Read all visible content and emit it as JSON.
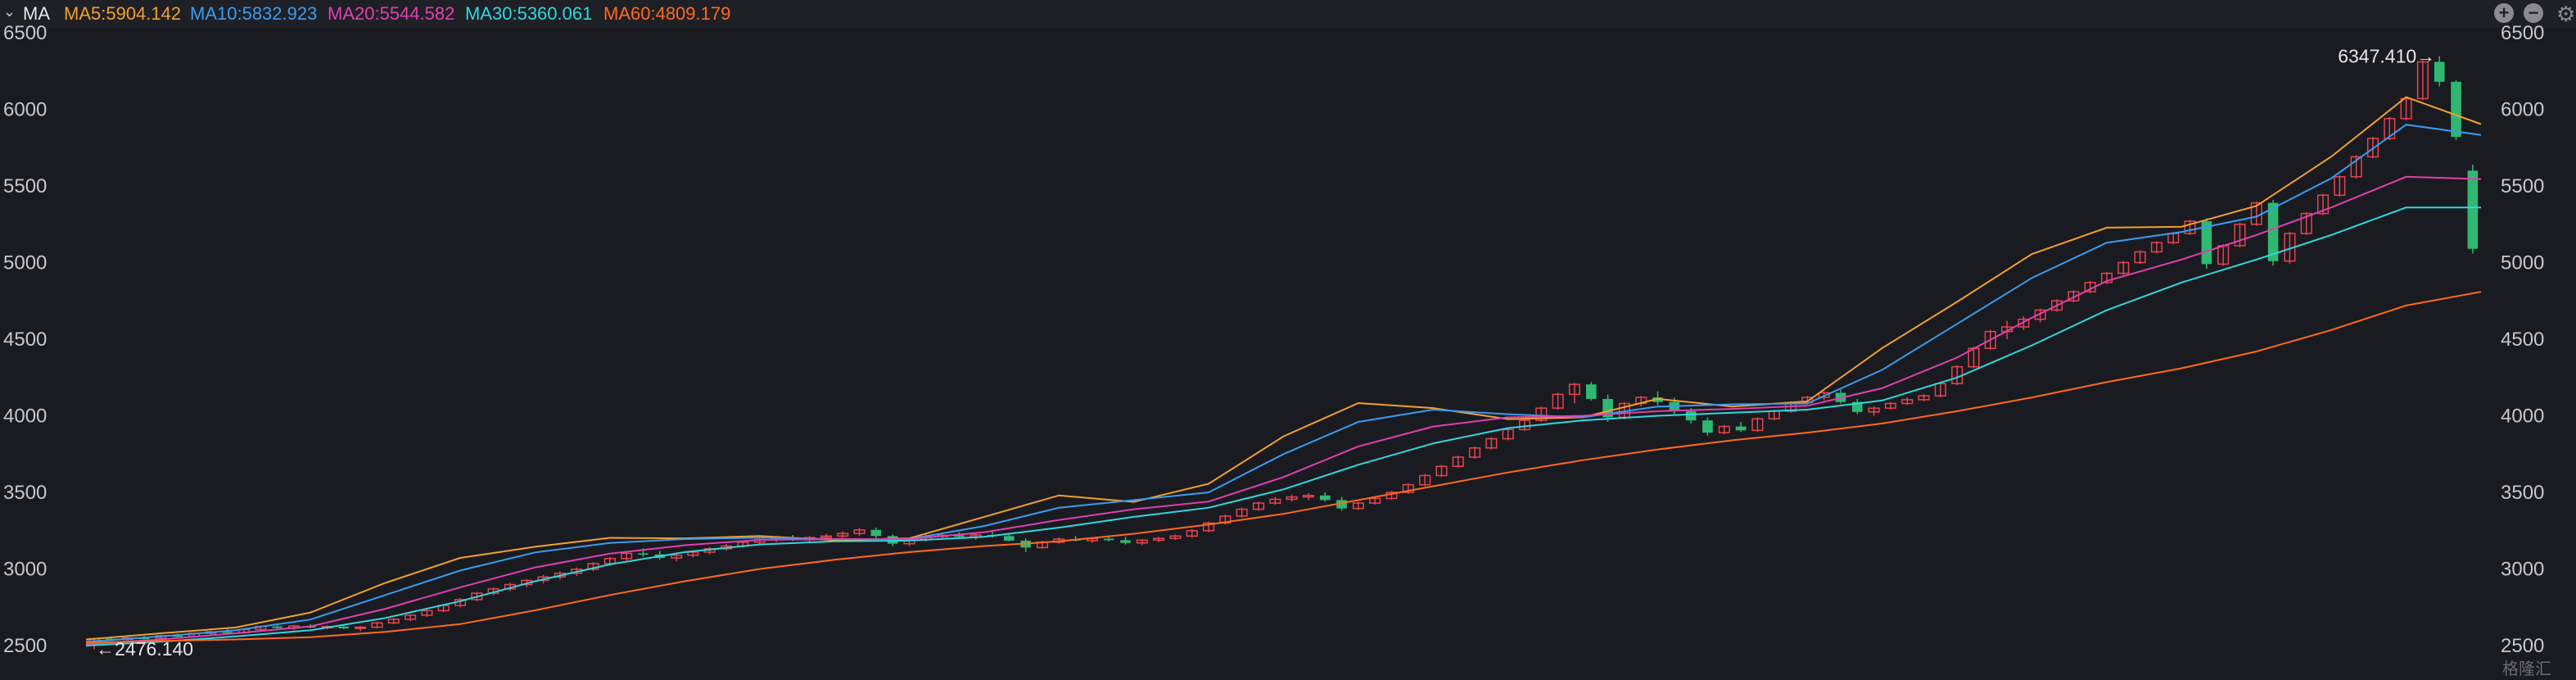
{
  "indicator": {
    "name": "MA",
    "ma": [
      {
        "label": "MA5:5904.142",
        "color": "#f0a030"
      },
      {
        "label": "MA10:5832.923",
        "color": "#3a9cf0"
      },
      {
        "label": "MA20:5544.582",
        "color": "#e040b0"
      },
      {
        "label": "MA30:5360.061",
        "color": "#30d8e0"
      },
      {
        "label": "MA60:4809.179",
        "color": "#ff6a20"
      }
    ]
  },
  "icons": {
    "collapse": "chevron-down-icon",
    "zoom_in": "plus-icon",
    "zoom_out": "minus-icon",
    "settings": "gear-icon"
  },
  "watermark": "格隆汇",
  "chart_data": {
    "type": "candlestick",
    "ylim": [
      2500,
      6500
    ],
    "yticks": [
      "6500",
      "6000",
      "5500",
      "5000",
      "4500",
      "4000",
      "3500",
      "3000",
      "2500"
    ],
    "grid": false,
    "annotations": {
      "high_label": "6347.410→",
      "low_label": "←2476.140"
    },
    "colors": {
      "up": "#e8434e",
      "down": "#2fb872"
    },
    "candles": [
      [
        2530,
        2550,
        2476,
        2545
      ],
      [
        2545,
        2552,
        2530,
        2540
      ],
      [
        2540,
        2555,
        2532,
        2550
      ],
      [
        2550,
        2562,
        2540,
        2548
      ],
      [
        2548,
        2570,
        2542,
        2565
      ],
      [
        2565,
        2578,
        2555,
        2560
      ],
      [
        2560,
        2585,
        2552,
        2580
      ],
      [
        2580,
        2598,
        2570,
        2590
      ],
      [
        2590,
        2608,
        2580,
        2585
      ],
      [
        2585,
        2612,
        2578,
        2605
      ],
      [
        2605,
        2630,
        2595,
        2625
      ],
      [
        2625,
        2645,
        2610,
        2615
      ],
      [
        2615,
        2635,
        2600,
        2628
      ],
      [
        2628,
        2640,
        2612,
        2618
      ],
      [
        2618,
        2632,
        2605,
        2624
      ],
      [
        2624,
        2636,
        2608,
        2612
      ],
      [
        2612,
        2628,
        2595,
        2620
      ],
      [
        2620,
        2655,
        2612,
        2648
      ],
      [
        2648,
        2680,
        2640,
        2672
      ],
      [
        2672,
        2705,
        2660,
        2698
      ],
      [
        2698,
        2735,
        2688,
        2728
      ],
      [
        2728,
        2770,
        2718,
        2762
      ],
      [
        2762,
        2810,
        2750,
        2800
      ],
      [
        2800,
        2850,
        2790,
        2842
      ],
      [
        2842,
        2880,
        2828,
        2870
      ],
      [
        2870,
        2910,
        2855,
        2898
      ],
      [
        2898,
        2935,
        2880,
        2925
      ],
      [
        2925,
        2962,
        2905,
        2948
      ],
      [
        2948,
        2985,
        2930,
        2972
      ],
      [
        2972,
        3010,
        2955,
        2998
      ],
      [
        2998,
        3045,
        2985,
        3035
      ],
      [
        3035,
        3080,
        3020,
        3068
      ],
      [
        3068,
        3115,
        3055,
        3102
      ],
      [
        3102,
        3135,
        3080,
        3095
      ],
      [
        3095,
        3118,
        3060,
        3072
      ],
      [
        3072,
        3100,
        3050,
        3090
      ],
      [
        3090,
        3120,
        3075,
        3110
      ],
      [
        3110,
        3145,
        3095,
        3132
      ],
      [
        3132,
        3165,
        3118,
        3150
      ],
      [
        3150,
        3188,
        3138,
        3175
      ],
      [
        3175,
        3205,
        3160,
        3192
      ],
      [
        3192,
        3215,
        3175,
        3200
      ],
      [
        3200,
        3222,
        3182,
        3190
      ],
      [
        3190,
        3215,
        3175,
        3205
      ],
      [
        3205,
        3230,
        3190,
        3215
      ],
      [
        3215,
        3245,
        3200,
        3232
      ],
      [
        3232,
        3268,
        3215,
        3255
      ],
      [
        3255,
        3270,
        3200,
        3215
      ],
      [
        3215,
        3225,
        3150,
        3165
      ],
      [
        3165,
        3200,
        3150,
        3192
      ],
      [
        3192,
        3225,
        3180,
        3212
      ],
      [
        3212,
        3235,
        3195,
        3220
      ],
      [
        3220,
        3240,
        3200,
        3210
      ],
      [
        3210,
        3230,
        3190,
        3222
      ],
      [
        3222,
        3245,
        3205,
        3215
      ],
      [
        3215,
        3230,
        3180,
        3185
      ],
      [
        3185,
        3200,
        3110,
        3140
      ],
      [
        3140,
        3185,
        3130,
        3175
      ],
      [
        3175,
        3205,
        3165,
        3195
      ],
      [
        3195,
        3215,
        3180,
        3185
      ],
      [
        3185,
        3205,
        3170,
        3198
      ],
      [
        3198,
        3212,
        3180,
        3188
      ],
      [
        3188,
        3210,
        3160,
        3170
      ],
      [
        3170,
        3195,
        3155,
        3188
      ],
      [
        3188,
        3210,
        3175,
        3200
      ],
      [
        3200,
        3225,
        3190,
        3215
      ],
      [
        3215,
        3260,
        3205,
        3250
      ],
      [
        3250,
        3310,
        3240,
        3300
      ],
      [
        3300,
        3355,
        3290,
        3345
      ],
      [
        3345,
        3400,
        3335,
        3390
      ],
      [
        3390,
        3440,
        3380,
        3430
      ],
      [
        3430,
        3470,
        3420,
        3455
      ],
      [
        3455,
        3485,
        3440,
        3470
      ],
      [
        3470,
        3495,
        3450,
        3480
      ],
      [
        3480,
        3500,
        3440,
        3450
      ],
      [
        3450,
        3470,
        3380,
        3395
      ],
      [
        3395,
        3440,
        3385,
        3430
      ],
      [
        3430,
        3470,
        3420,
        3460
      ],
      [
        3460,
        3510,
        3450,
        3500
      ],
      [
        3500,
        3560,
        3490,
        3550
      ],
      [
        3550,
        3620,
        3540,
        3610
      ],
      [
        3610,
        3680,
        3600,
        3670
      ],
      [
        3670,
        3740,
        3660,
        3730
      ],
      [
        3730,
        3800,
        3720,
        3790
      ],
      [
        3790,
        3860,
        3780,
        3850
      ],
      [
        3850,
        3920,
        3840,
        3910
      ],
      [
        3910,
        3980,
        3900,
        3970
      ],
      [
        3970,
        4060,
        3960,
        4050
      ],
      [
        4050,
        4150,
        4040,
        4140
      ],
      [
        4140,
        4215,
        4080,
        4205
      ],
      [
        4205,
        4220,
        4100,
        4110
      ],
      [
        4110,
        4140,
        3960,
        3990
      ],
      [
        3990,
        4090,
        3975,
        4080
      ],
      [
        4080,
        4130,
        4060,
        4120
      ],
      [
        4120,
        4160,
        4070,
        4090
      ],
      [
        4090,
        4120,
        4010,
        4030
      ],
      [
        4030,
        4050,
        3950,
        3970
      ],
      [
        3970,
        3990,
        3870,
        3890
      ],
      [
        3890,
        3940,
        3880,
        3930
      ],
      [
        3930,
        3960,
        3895,
        3905
      ],
      [
        3905,
        3990,
        3895,
        3980
      ],
      [
        3980,
        4040,
        3970,
        4030
      ],
      [
        4030,
        4095,
        4020,
        4085
      ],
      [
        4085,
        4130,
        4075,
        4120
      ],
      [
        4120,
        4160,
        4100,
        4150
      ],
      [
        4150,
        4170,
        4080,
        4090
      ],
      [
        4090,
        4110,
        4010,
        4025
      ],
      [
        4025,
        4060,
        4000,
        4050
      ],
      [
        4050,
        4090,
        4040,
        4080
      ],
      [
        4080,
        4120,
        4070,
        4105
      ],
      [
        4105,
        4140,
        4095,
        4130
      ],
      [
        4130,
        4220,
        4120,
        4210
      ],
      [
        4210,
        4330,
        4200,
        4320
      ],
      [
        4320,
        4450,
        4310,
        4440
      ],
      [
        4440,
        4560,
        4430,
        4550
      ],
      [
        4550,
        4620,
        4500,
        4580
      ],
      [
        4580,
        4650,
        4560,
        4630
      ],
      [
        4630,
        4700,
        4610,
        4690
      ],
      [
        4690,
        4760,
        4680,
        4750
      ],
      [
        4750,
        4820,
        4740,
        4810
      ],
      [
        4810,
        4880,
        4800,
        4870
      ],
      [
        4870,
        4940,
        4860,
        4930
      ],
      [
        4930,
        5010,
        4920,
        5000
      ],
      [
        5000,
        5080,
        4990,
        5070
      ],
      [
        5070,
        5140,
        5060,
        5130
      ],
      [
        5130,
        5200,
        5120,
        5190
      ],
      [
        5190,
        5280,
        5180,
        5270
      ],
      [
        5270,
        5290,
        4960,
        4990
      ],
      [
        4990,
        5120,
        4980,
        5110
      ],
      [
        5110,
        5260,
        5100,
        5250
      ],
      [
        5250,
        5400,
        5240,
        5390
      ],
      [
        5390,
        5410,
        4980,
        5010
      ],
      [
        5010,
        5200,
        4990,
        5190
      ],
      [
        5190,
        5330,
        5180,
        5320
      ],
      [
        5320,
        5450,
        5310,
        5440
      ],
      [
        5440,
        5570,
        5430,
        5560
      ],
      [
        5560,
        5700,
        5550,
        5690
      ],
      [
        5690,
        5820,
        5680,
        5810
      ],
      [
        5810,
        5950,
        5800,
        5940
      ],
      [
        5940,
        6080,
        5930,
        6070
      ],
      [
        6070,
        6320,
        6060,
        6310
      ],
      [
        6310,
        6347.41,
        6150,
        6180
      ],
      [
        6180,
        6190,
        5800,
        5820
      ],
      [
        5600,
        5640,
        5060,
        5090
      ]
    ],
    "series": [
      {
        "name": "MA5",
        "color": "#f0a030",
        "values": [
          2540,
          2580,
          2618,
          2716,
          2909,
          3072,
          3145,
          3203,
          3200,
          3215,
          3189,
          3200,
          3340,
          3480,
          3438,
          3556,
          3866,
          4083,
          4050,
          3978,
          3990,
          4110,
          4060,
          4094,
          4442,
          4744,
          5056,
          5228,
          5234,
          5370,
          5692,
          6080,
          5904
        ]
      },
      {
        "name": "MA10",
        "color": "#3a9cf0",
        "values": [
          2525,
          2560,
          2600,
          2670,
          2830,
          2990,
          3108,
          3170,
          3195,
          3205,
          3195,
          3195,
          3280,
          3400,
          3450,
          3500,
          3750,
          3960,
          4040,
          4010,
          3990,
          4060,
          4075,
          4080,
          4300,
          4600,
          4900,
          5130,
          5200,
          5300,
          5550,
          5900,
          5833
        ]
      },
      {
        "name": "MA20",
        "color": "#e040b0",
        "values": [
          2510,
          2540,
          2580,
          2625,
          2740,
          2880,
          3010,
          3100,
          3155,
          3190,
          3195,
          3195,
          3240,
          3320,
          3390,
          3440,
          3600,
          3800,
          3930,
          3990,
          4000,
          4030,
          4045,
          4065,
          4180,
          4380,
          4640,
          4880,
          5020,
          5180,
          5360,
          5560,
          5545
        ]
      },
      {
        "name": "MA30",
        "color": "#30d8e0",
        "values": [
          2500,
          2525,
          2560,
          2600,
          2680,
          2790,
          2920,
          3030,
          3110,
          3160,
          3180,
          3185,
          3210,
          3270,
          3340,
          3400,
          3520,
          3680,
          3820,
          3920,
          3970,
          4000,
          4020,
          4040,
          4100,
          4250,
          4460,
          4690,
          4870,
          5020,
          5180,
          5360,
          5360
        ]
      },
      {
        "name": "MA60",
        "color": "#ff6a20",
        "values": [
          2520,
          2530,
          2540,
          2555,
          2590,
          2640,
          2730,
          2830,
          2920,
          3000,
          3060,
          3110,
          3150,
          3180,
          3230,
          3290,
          3360,
          3450,
          3540,
          3630,
          3710,
          3780,
          3840,
          3890,
          3950,
          4030,
          4120,
          4220,
          4310,
          4420,
          4560,
          4720,
          4809
        ]
      }
    ]
  }
}
